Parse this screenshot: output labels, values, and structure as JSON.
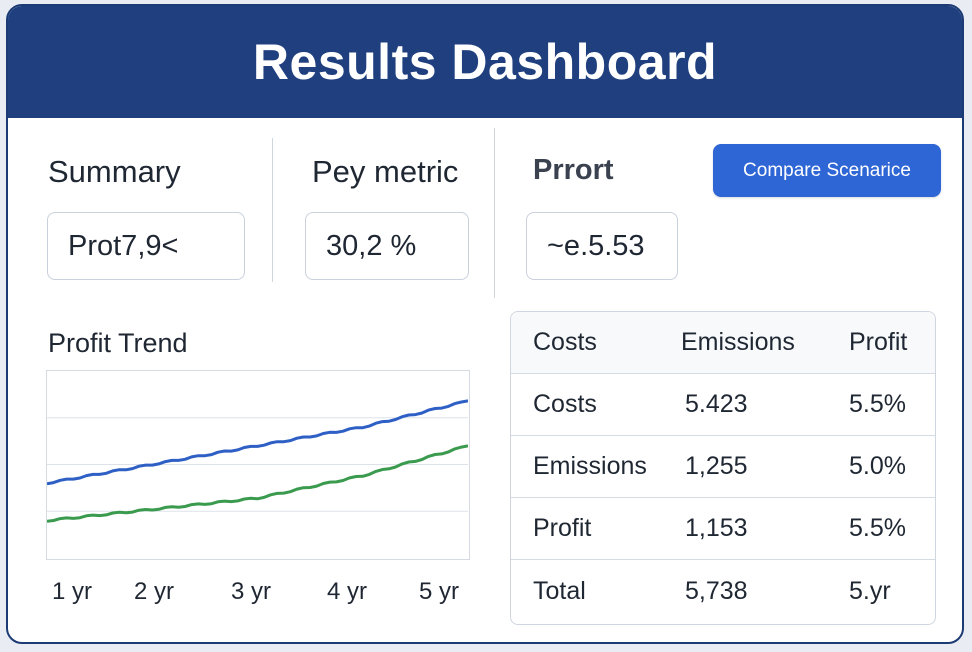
{
  "header": {
    "title": "Results Dashboard"
  },
  "metrics": [
    {
      "label": "Summary",
      "value": "Prot7,9<"
    },
    {
      "label": "Pey metric",
      "value": "30,2 %"
    },
    {
      "label": "Prrort",
      "value": "~e.5.53"
    }
  ],
  "compare_button": {
    "label": "Compare Scenarice"
  },
  "chart": {
    "title": "Profit Trend",
    "x_ticks": [
      "1 yr",
      "2 yr",
      "3 yr",
      "4 yr",
      "5 yr"
    ]
  },
  "chart_data": {
    "type": "line",
    "title": "Profit Trend",
    "x": [
      "1 yr",
      "2 yr",
      "3 yr",
      "4 yr",
      "5 yr"
    ],
    "series": [
      {
        "color": "#2d5fc4",
        "values": [
          2.0,
          2.5,
          3.0,
          3.5,
          4.2
        ]
      },
      {
        "color": "#3a9a4e",
        "values": [
          1.0,
          1.3,
          1.6,
          2.2,
          3.0
        ]
      }
    ],
    "ylim": [
      0,
      5
    ],
    "grid": true
  },
  "table": {
    "headers": [
      "Costs",
      "Emissions",
      "Profit"
    ],
    "rows": [
      [
        "Costs",
        "5.423",
        "5.5%"
      ],
      [
        "Emissions",
        "1,255",
        "5.0%"
      ],
      [
        "Profit",
        "1,153",
        "5.5%"
      ],
      [
        "Total",
        "5,738",
        "5.yr"
      ]
    ]
  }
}
